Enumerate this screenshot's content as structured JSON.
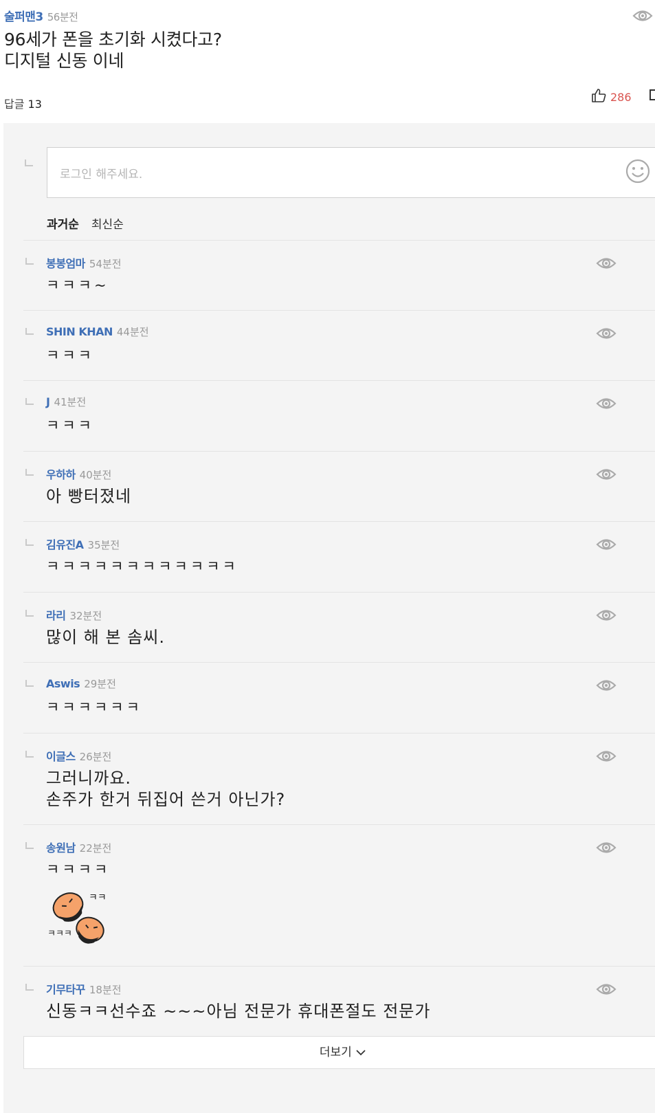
{
  "post": {
    "author": "술퍼맨3",
    "time": "56분전",
    "text": "96세가 폰을 초기화 시켰다고?\n디지털 신동 이네",
    "reply_label": "답글",
    "reply_count": "13",
    "likes": "286"
  },
  "reply_input": {
    "placeholder": "로그인 해주세요."
  },
  "sort": {
    "oldest": "과거순",
    "newest": "최신순"
  },
  "comments": [
    {
      "author": "봉봉엄마",
      "time": "54분전",
      "text": "ㅋㅋㅋ~"
    },
    {
      "author": "SHIN KHAN",
      "time": "44분전",
      "text": "ㅋㅋㅋ"
    },
    {
      "author": "J",
      "time": "41분전",
      "text": "ㅋㅋㅋ"
    },
    {
      "author": "우하하",
      "time": "40분전",
      "text": "아 빵터졌네"
    },
    {
      "author": "김유진A",
      "time": "35분전",
      "text": "ㅋㅋㅋㅋㅋㅋㅋㅋㅋㅋㅋㅋ"
    },
    {
      "author": "라리",
      "time": "32분전",
      "text": "많이 해 본 솜씨."
    },
    {
      "author": "Aswis",
      "time": "29분전",
      "text": "ㅋㅋㅋㅋㅋㅋ"
    },
    {
      "author": "이글스",
      "time": "26분전",
      "text": "그러니까요.\n손주가 한거 뒤집어 쓴거 아닌가?"
    },
    {
      "author": "송원남",
      "time": "22분전",
      "text": "ㅋㅋㅋㅋ",
      "sticker_text": [
        "ㅋㅋ",
        "ㅋㅋㅋ"
      ]
    },
    {
      "author": "기무타꾸",
      "time": "18분전",
      "text": "신동ㅋㅋ선수죠 ~~~아님 전문가 휴대폰절도 전문가"
    }
  ],
  "more_button": {
    "label": "더보기"
  },
  "colors": {
    "author": "#3f6fb6",
    "likes": "#d9534f",
    "reply_bg": "#f4f4f4"
  },
  "icons": {
    "view": "eye-icon",
    "like": "thumbs-up-icon",
    "emoji": "smile-icon",
    "expand": "chevron-down-icon"
  }
}
